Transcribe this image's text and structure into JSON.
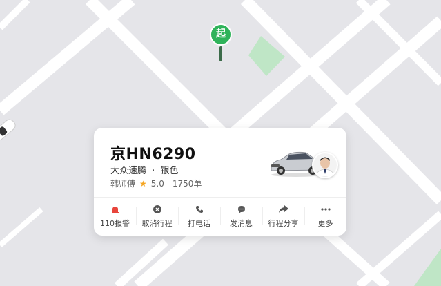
{
  "map": {
    "pin_label": "起"
  },
  "driver": {
    "plate": "京HN6290",
    "car_model": "大众速腾",
    "separator": "·",
    "car_color": "银色",
    "name": "韩师傅",
    "rating": "5.0",
    "orders": "1750单"
  },
  "actions": [
    {
      "label": "110报警",
      "icon": "alarm-icon"
    },
    {
      "label": "取消行程",
      "icon": "cancel-icon"
    },
    {
      "label": "打电话",
      "icon": "phone-icon"
    },
    {
      "label": "发消息",
      "icon": "message-icon"
    },
    {
      "label": "行程分享",
      "icon": "share-icon"
    },
    {
      "label": "更多",
      "icon": "more-icon"
    }
  ],
  "colors": {
    "map_bg": "#e5e5e9",
    "road": "#ffffff",
    "green_area": "#bfe6c6",
    "pin_green": "#2fb35a",
    "alarm_red": "#e8453c",
    "star": "#f5a623"
  }
}
